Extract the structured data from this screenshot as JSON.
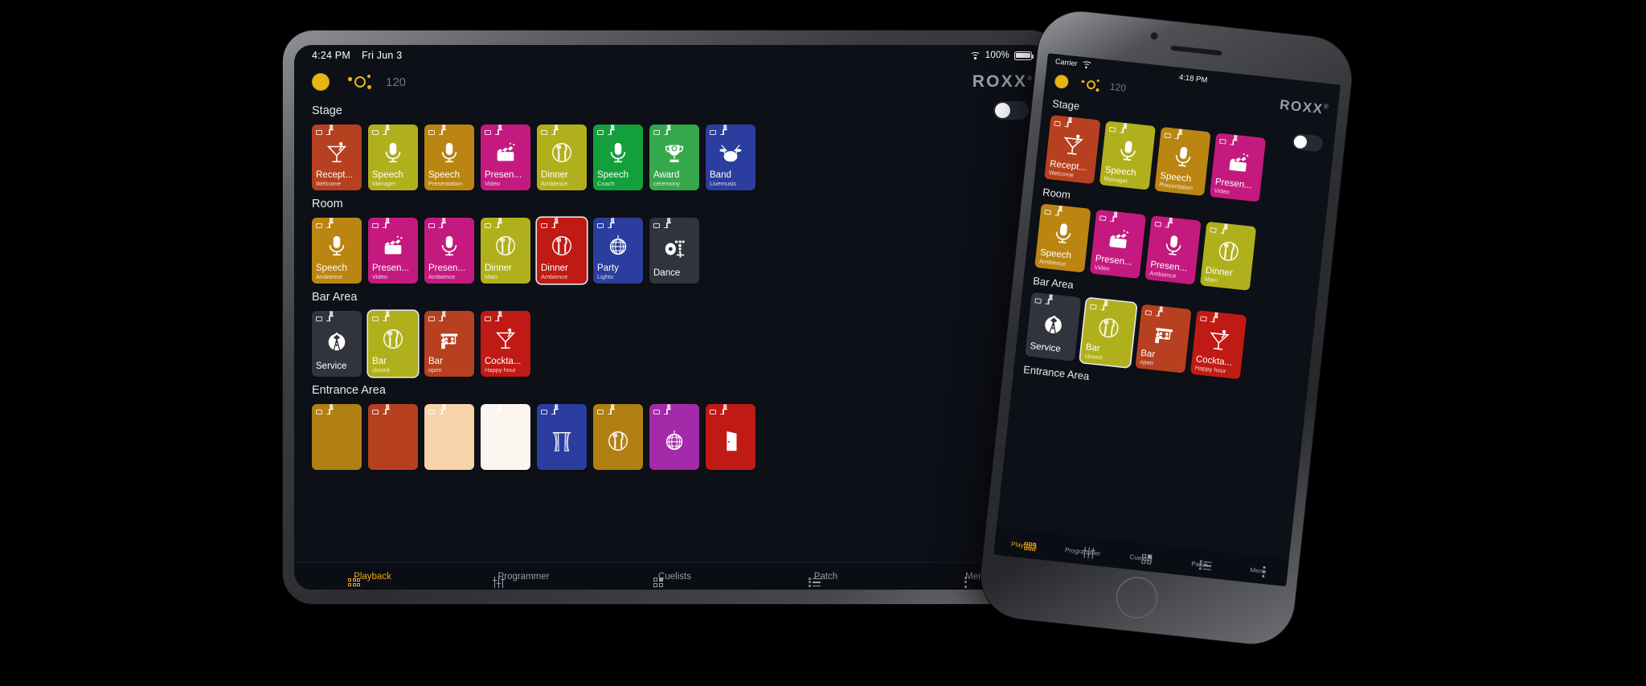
{
  "tablet": {
    "statusbar": {
      "time": "4:24 PM",
      "date": "Fri Jun 3",
      "battery": "100%"
    },
    "header": {
      "bpm": "120",
      "brand": "ROXX",
      "trademark": "®"
    },
    "groups": [
      {
        "title": "Stage",
        "tiles": [
          {
            "name": "Recept...",
            "sub": "Welcome",
            "color": "#b6401f",
            "icon": "cocktail-icon",
            "selected": false
          },
          {
            "name": "Speech",
            "sub": "Manager",
            "color": "#b0b01c",
            "icon": "microphone-icon",
            "selected": false
          },
          {
            "name": "Speech",
            "sub": "Presentation",
            "color": "#bb8512",
            "icon": "microphone-icon",
            "selected": false
          },
          {
            "name": "Presen...",
            "sub": "Video",
            "color": "#c41a7f",
            "icon": "clapperboard-icon",
            "selected": false
          },
          {
            "name": "Dinner",
            "sub": "Ambience",
            "color": "#b0b01c",
            "icon": "dinner-icon",
            "selected": false
          },
          {
            "name": "Speech",
            "sub": "Coach",
            "color": "#13a03c",
            "icon": "microphone-icon",
            "selected": false
          },
          {
            "name": "Award",
            "sub": "ceremony",
            "color": "#35a84b",
            "icon": "trophy-icon",
            "selected": false
          },
          {
            "name": "Band",
            "sub": "Livemusic",
            "color": "#2b3d9e",
            "icon": "drums-icon",
            "selected": false
          }
        ]
      },
      {
        "title": "Room",
        "tiles": [
          {
            "name": "Speech",
            "sub": "Ambience",
            "color": "#bb8512",
            "icon": "microphone-icon",
            "selected": false
          },
          {
            "name": "Presen...",
            "sub": "Video",
            "color": "#c41a7f",
            "icon": "clapperboard-icon",
            "selected": false
          },
          {
            "name": "Presen...",
            "sub": "Ambience",
            "color": "#c41a7f",
            "icon": "microphone-icon",
            "selected": false
          },
          {
            "name": "Dinner",
            "sub": "Main",
            "color": "#b0b01c",
            "icon": "dinner-icon",
            "selected": false
          },
          {
            "name": "Dinner",
            "sub": "Ambience",
            "color": "#c01a14",
            "icon": "dinner-icon",
            "selected": true
          },
          {
            "name": "Party",
            "sub": "Lights",
            "color": "#2b3d9e",
            "icon": "discoball-icon",
            "selected": false
          },
          {
            "name": "Dance",
            "sub": "",
            "color": "#32343d",
            "icon": "dance-icon",
            "selected": false
          }
        ]
      },
      {
        "title": "Bar Area",
        "tiles": [
          {
            "name": "Service",
            "sub": "",
            "color": "#32343d",
            "icon": "bowtie-icon",
            "selected": false
          },
          {
            "name": "Bar",
            "sub": "closed",
            "color": "#b0b01c",
            "icon": "dinner-icon",
            "selected": true
          },
          {
            "name": "Bar",
            "sub": "open",
            "color": "#b6401f",
            "icon": "barcounter-icon",
            "selected": false
          },
          {
            "name": "Cockta...",
            "sub": "Happy hour",
            "color": "#c01a14",
            "icon": "cocktail-icon",
            "selected": false
          }
        ]
      },
      {
        "title": "Entrance Area",
        "tiles": [
          {
            "name": "",
            "sub": "",
            "color": "#b08013",
            "icon": "",
            "selected": false
          },
          {
            "name": "",
            "sub": "",
            "color": "#b6401f",
            "icon": "",
            "selected": false
          },
          {
            "name": "",
            "sub": "",
            "color": "#f6d3a8",
            "icon": "",
            "selected": false
          },
          {
            "name": "",
            "sub": "",
            "color": "#fbf5f0",
            "icon": "",
            "selected": false
          },
          {
            "name": "",
            "sub": "",
            "color": "#2b3d9e",
            "icon": "curtain-icon",
            "selected": false
          },
          {
            "name": "",
            "sub": "",
            "color": "#b08013",
            "icon": "dinner-icon",
            "selected": false
          },
          {
            "name": "",
            "sub": "",
            "color": "#a32aa8",
            "icon": "discoball-icon",
            "selected": false
          },
          {
            "name": "",
            "sub": "",
            "color": "#c01a14",
            "icon": "door-icon",
            "selected": false
          }
        ]
      }
    ],
    "nav": [
      {
        "label": "Playback",
        "icon": "grid-icon",
        "active": true
      },
      {
        "label": "Programmer",
        "icon": "fader-icon",
        "active": false
      },
      {
        "label": "Cuelists",
        "icon": "cue-icon",
        "active": false
      },
      {
        "label": "Patch",
        "icon": "patch-icon",
        "active": false
      },
      {
        "label": "Menu",
        "icon": "kebab-icon",
        "active": false
      }
    ]
  },
  "phone": {
    "statusbar": {
      "carrier": "Carrier",
      "time": "4:18 PM"
    },
    "header": {
      "bpm": "120",
      "brand": "ROXX",
      "trademark": "®"
    },
    "groups": [
      {
        "title": "Stage",
        "tiles": [
          {
            "name": "Recept...",
            "sub": "Welcome",
            "color": "#b6401f",
            "icon": "cocktail-icon",
            "selected": false
          },
          {
            "name": "Speech",
            "sub": "Manager",
            "color": "#b0b01c",
            "icon": "microphone-icon",
            "selected": false
          },
          {
            "name": "Speech",
            "sub": "Presentation",
            "color": "#bb8512",
            "icon": "microphone-icon",
            "selected": false
          },
          {
            "name": "Presen...",
            "sub": "Video",
            "color": "#c41a7f",
            "icon": "clapperboard-icon",
            "selected": false
          }
        ]
      },
      {
        "title": "Room",
        "tiles": [
          {
            "name": "Speech",
            "sub": "Ambience",
            "color": "#bb8512",
            "icon": "microphone-icon",
            "selected": false
          },
          {
            "name": "Presen...",
            "sub": "Video",
            "color": "#c41a7f",
            "icon": "clapperboard-icon",
            "selected": false
          },
          {
            "name": "Presen...",
            "sub": "Ambience",
            "color": "#c41a7f",
            "icon": "microphone-icon",
            "selected": false
          },
          {
            "name": "Dinner",
            "sub": "Main",
            "color": "#b0b01c",
            "icon": "dinner-icon",
            "selected": false
          }
        ]
      },
      {
        "title": "Bar Area",
        "tiles": [
          {
            "name": "Service",
            "sub": "",
            "color": "#32343d",
            "icon": "bowtie-icon",
            "selected": false
          },
          {
            "name": "Bar",
            "sub": "closed",
            "color": "#b0b01c",
            "icon": "dinner-icon",
            "selected": true
          },
          {
            "name": "Bar",
            "sub": "open",
            "color": "#b6401f",
            "icon": "barcounter-icon",
            "selected": false
          },
          {
            "name": "Cockta...",
            "sub": "Happy hour",
            "color": "#c01a14",
            "icon": "cocktail-icon",
            "selected": false
          }
        ]
      },
      {
        "title": "Entrance Area",
        "tiles": []
      }
    ],
    "nav": [
      {
        "label": "Playback",
        "icon": "grid-icon",
        "active": true
      },
      {
        "label": "Programmer",
        "icon": "fader-icon",
        "active": false
      },
      {
        "label": "Cuelists",
        "icon": "cue-icon",
        "active": false
      },
      {
        "label": "Patch",
        "icon": "patch-icon",
        "active": false
      },
      {
        "label": "Menu",
        "icon": "kebab-icon",
        "active": false
      }
    ]
  }
}
